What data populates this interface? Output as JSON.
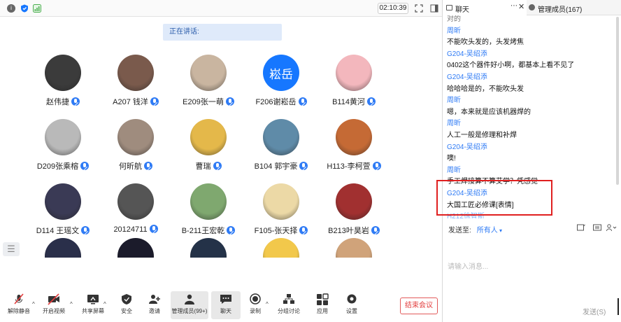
{
  "topbar": {
    "time": "02:10:39"
  },
  "speaking": {
    "label": "正在讲话:"
  },
  "participants": [
    {
      "name": "赵伟捷",
      "avatar_color": "#3b3b3b"
    },
    {
      "name": "A207 钱洋",
      "avatar_color": "#7a5a4c"
    },
    {
      "name": "E209张一萌",
      "avatar_color": "#c9b5a0"
    },
    {
      "name": "F206谢崧岳",
      "avatar_text": "崧岳",
      "avatar_color": "#1677ff"
    },
    {
      "name": "B114黄河",
      "avatar_color": "#f3b7bd"
    },
    {
      "name": "D209张乘榕",
      "avatar_color": "#b9b9b9"
    },
    {
      "name": "何昕航",
      "avatar_color": "#9f8c7e"
    },
    {
      "name": "曹瑞",
      "avatar_color": "#e4b84a"
    },
    {
      "name": "B104 郭宇豪",
      "avatar_color": "#5f8ba8"
    },
    {
      "name": "H113-李柯萱",
      "avatar_color": "#c56a35"
    },
    {
      "name": "D114 王瑶文",
      "avatar_color": "#3a3a55"
    },
    {
      "name": "20124711",
      "avatar_color": "#555555"
    },
    {
      "name": "B-211王宏乾",
      "avatar_color": "#7fa86f"
    },
    {
      "name": "F105-张天择",
      "avatar_color": "#ecd9a6"
    },
    {
      "name": "B213叶昊岩",
      "avatar_color": "#a13030"
    },
    {
      "name": "",
      "avatar_color": "#2a2f4a"
    },
    {
      "name": "",
      "avatar_color": "#1b1b2b"
    },
    {
      "name": "",
      "avatar_color": "#243248"
    },
    {
      "name": "",
      "avatar_color": "#f2c84b"
    },
    {
      "name": "",
      "avatar_color": "#d0a37a"
    }
  ],
  "toolbar": {
    "items": [
      {
        "label": "解除静音",
        "icon": "mic-muted-icon"
      },
      {
        "label": "开启视频",
        "icon": "camera-off-icon"
      },
      {
        "label": "共享屏幕",
        "icon": "share-screen-icon"
      },
      {
        "label": "安全",
        "icon": "shield-icon"
      },
      {
        "label": "邀请",
        "icon": "invite-icon"
      },
      {
        "label": "管理成员(99+)",
        "icon": "members-icon"
      },
      {
        "label": "聊天",
        "icon": "chat-icon"
      },
      {
        "label": "录制",
        "icon": "record-icon"
      },
      {
        "label": "分组讨论",
        "icon": "breakout-icon"
      },
      {
        "label": "应用",
        "icon": "apps-icon"
      },
      {
        "label": "设置",
        "icon": "settings-icon"
      }
    ],
    "end_label": "结束会议"
  },
  "panel": {
    "chat_tab": "聊天",
    "members_tab": "管理成员(167)",
    "messages": [
      {
        "kind": "text",
        "text": "对的"
      },
      {
        "kind": "sender",
        "text": "周昕"
      },
      {
        "kind": "text",
        "text": "不能吹头发的，头发烤焦"
      },
      {
        "kind": "sender",
        "text": "G204-吴绍添"
      },
      {
        "kind": "text",
        "text": "0402这个器件好小啊，都基本上看不见了"
      },
      {
        "kind": "sender",
        "text": "G204-吴绍添"
      },
      {
        "kind": "text",
        "text": "哈哈哈是的，不能吹头发"
      },
      {
        "kind": "sender",
        "text": "周昕"
      },
      {
        "kind": "text",
        "text": "嗯，本来就是应该机器焊的"
      },
      {
        "kind": "sender",
        "text": "周昕"
      },
      {
        "kind": "text",
        "text": "人工一般是修理和补焊"
      },
      {
        "kind": "sender",
        "text": "G204-吴绍添"
      },
      {
        "kind": "text",
        "text": "噢!"
      },
      {
        "kind": "sender",
        "text": "周昕"
      },
      {
        "kind": "text",
        "text": "手工焊接算不算艾学？凭感觉"
      },
      {
        "kind": "sender",
        "text": "G204-吴绍添"
      },
      {
        "kind": "text",
        "text": "大国工匠必修课[表情]"
      },
      {
        "kind": "sender",
        "text": "H212徐智斯"
      }
    ],
    "send_to_label": "发送至:",
    "send_to_value": "所有人",
    "input_placeholder": "请输入消息...",
    "send_label": "发送(S)"
  },
  "colors": {
    "accent": "#2f7bf5",
    "highlight": "#e02020",
    "end": "#e23c3c"
  }
}
